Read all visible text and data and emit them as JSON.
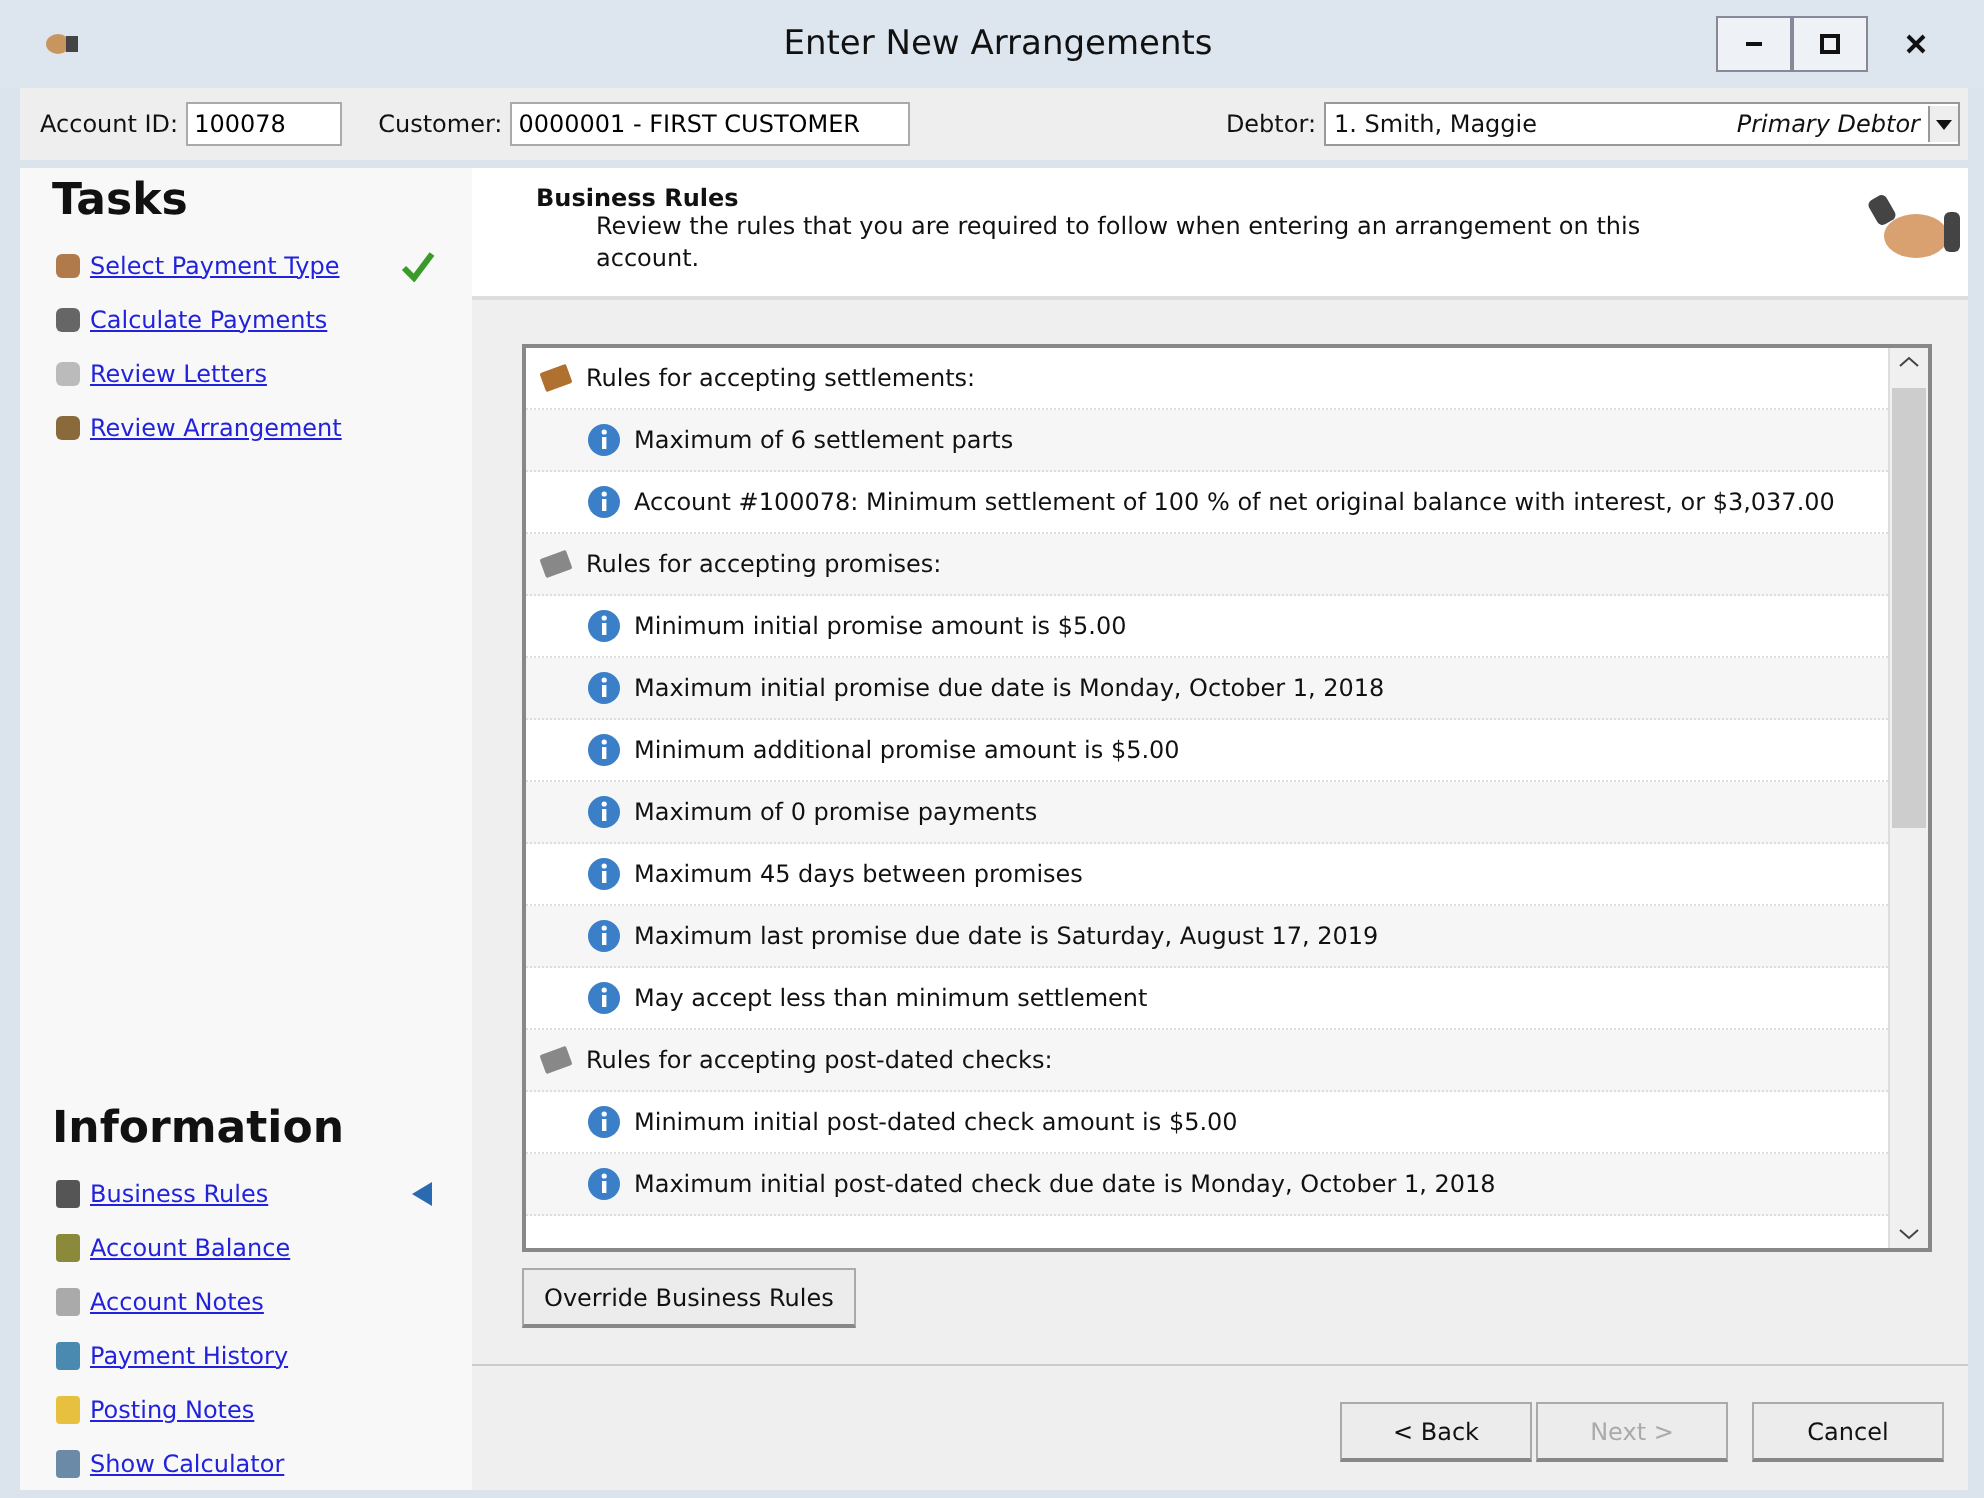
{
  "window": {
    "title": "Enter New Arrangements"
  },
  "toolbar": {
    "account_id": {
      "label": "Account ID:",
      "value": "100078"
    },
    "customer": {
      "label": "Customer:",
      "value": "0000001 - FIRST CUSTOMER"
    },
    "debtor": {
      "label": "Debtor:",
      "value": "1. Smith, Maggie",
      "role": "Primary Debtor"
    }
  },
  "tasks": {
    "title": "Tasks",
    "items": [
      {
        "label": "Select Payment Type",
        "done": true
      },
      {
        "label": "Calculate Payments",
        "done": false
      },
      {
        "label": "Review Letters",
        "done": false
      },
      {
        "label": "Review Arrangement",
        "done": false
      }
    ]
  },
  "information": {
    "title": "Information",
    "items": [
      {
        "label": "Business Rules",
        "selected": true
      },
      {
        "label": "Account Balance",
        "selected": false
      },
      {
        "label": "Account Notes",
        "selected": false
      },
      {
        "label": "Payment History",
        "selected": false
      },
      {
        "label": "Posting Notes",
        "selected": false
      },
      {
        "label": "Show Calculator",
        "selected": false
      }
    ]
  },
  "header": {
    "title": "Business Rules",
    "description": "Review the rules that you are required to follow when entering an arrangement on this account."
  },
  "rules": [
    {
      "kind": "group",
      "text": "Rules for accepting settlements:"
    },
    {
      "kind": "rule",
      "text": "Maximum of 6 settlement parts"
    },
    {
      "kind": "rule",
      "text": "Account #100078: Minimum settlement of 100 % of net original balance with interest, or $3,037.00"
    },
    {
      "kind": "group",
      "text": "Rules for accepting promises:"
    },
    {
      "kind": "rule",
      "text": "Minimum initial promise amount is $5.00"
    },
    {
      "kind": "rule",
      "text": "Maximum initial promise due date is Monday, October 1, 2018"
    },
    {
      "kind": "rule",
      "text": "Minimum additional promise amount is $5.00"
    },
    {
      "kind": "rule",
      "text": "Maximum of 0 promise payments"
    },
    {
      "kind": "rule",
      "text": "Maximum 45 days between promises"
    },
    {
      "kind": "rule",
      "text": "Maximum last promise due date is Saturday, August 17, 2019"
    },
    {
      "kind": "rule",
      "text": "May accept less than minimum settlement"
    },
    {
      "kind": "group",
      "text": "Rules for accepting post-dated checks:"
    },
    {
      "kind": "rule",
      "text": "Minimum initial post-dated check amount is $5.00"
    },
    {
      "kind": "rule",
      "text": "Maximum initial post-dated check due date is Monday, October 1, 2018"
    }
  ],
  "override_button": "Override Business Rules",
  "buttons": [
    {
      "label": "< Back",
      "disabled": false
    },
    {
      "label": "Next >",
      "disabled": true
    },
    {
      "label": "Cancel",
      "disabled": false
    }
  ]
}
